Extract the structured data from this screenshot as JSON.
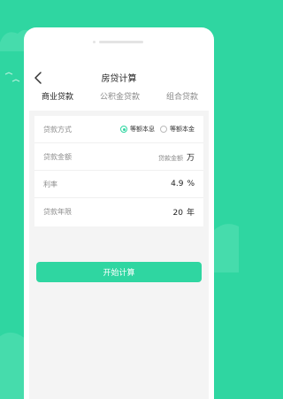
{
  "nav": {
    "title": "房贷计算"
  },
  "tabs": [
    {
      "label": "商业贷款",
      "active": true
    },
    {
      "label": "公积金贷款",
      "active": false
    },
    {
      "label": "组合贷款",
      "active": false
    }
  ],
  "form": {
    "method": {
      "label": "贷款方式",
      "options": [
        {
          "label": "等额本息",
          "selected": true
        },
        {
          "label": "等额本金",
          "selected": false
        }
      ]
    },
    "amount": {
      "label": "贷款金额",
      "placeholder": "贷款金额",
      "unit": "万"
    },
    "rate": {
      "label": "利率",
      "value": "4.9",
      "unit": "%"
    },
    "years": {
      "label": "贷款年限",
      "value": "20",
      "unit": "年"
    }
  },
  "button": {
    "label": "开始计算"
  },
  "colors": {
    "accent": "#2fd6a1",
    "background": "#2fd6a1"
  }
}
